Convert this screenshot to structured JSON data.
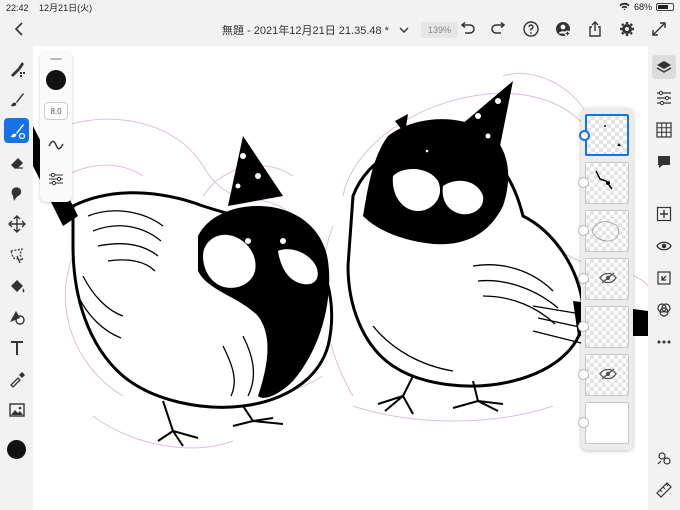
{
  "status_bar": {
    "time": "22:42",
    "date": "12月21日(火)",
    "battery": "68%",
    "battery_level": 0.68
  },
  "document": {
    "title": "無題 - 2021年12月21日 21.35.48 *",
    "zoom": "139%"
  },
  "top_icons": [
    "undo-icon",
    "redo-icon",
    "help-icon",
    "account-icon",
    "share-icon",
    "settings-icon",
    "fullscreen-icon"
  ],
  "left_tools": [
    "pixel-brush-icon",
    "live-brush-icon",
    "vector-brush-icon",
    "eraser-icon",
    "smudge-icon",
    "move-icon",
    "lasso-icon",
    "fill-icon",
    "shape-icon",
    "text-icon",
    "eyedropper-icon",
    "image-icon"
  ],
  "brush_panel": {
    "size": "8.0"
  },
  "colors": {
    "accent": "#1473e6",
    "current_color": "#111111",
    "sketch_pink": "#d8b4d4"
  },
  "layers": {
    "count": 7,
    "selected_index": 0
  },
  "right_tools": [
    "layers-icon",
    "properties-icon",
    "grid-icon",
    "comment-icon",
    "add-layer-icon",
    "visibility-icon",
    "import-icon",
    "blend-icon",
    "more-icon",
    "pen-settings-icon",
    "ruler-icon"
  ]
}
